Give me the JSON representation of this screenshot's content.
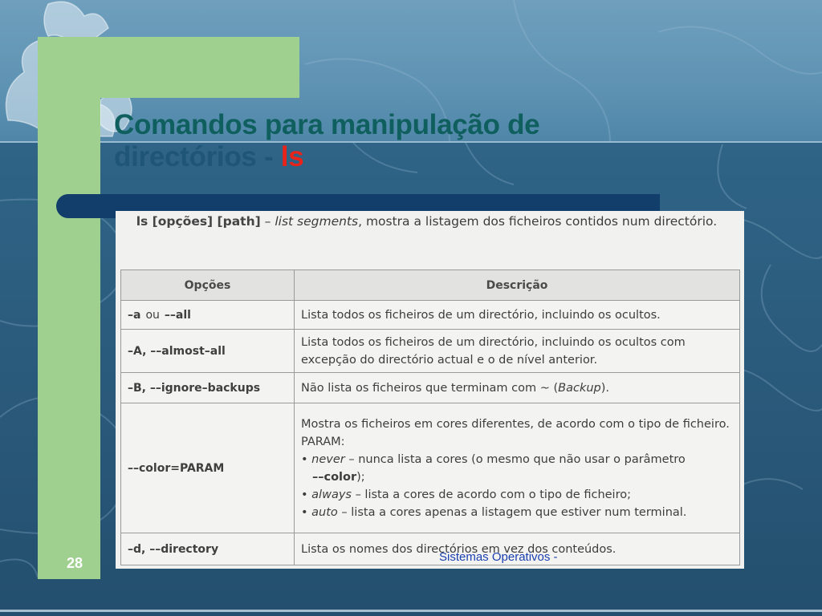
{
  "slide": {
    "title_line1": "Comandos para manipulação de",
    "title_line2": "directórios - ",
    "title_command": "ls",
    "slide_number": "28",
    "footer": "Sistemas Operativos -"
  },
  "doc": {
    "intro_syntax": "ls [opções] [path]",
    "intro_dash": " – ",
    "intro_italic": "list segments",
    "intro_rest": ", mostra a listagem dos ficheiros contidos num directório.",
    "table_headers": {
      "options": "Opções",
      "description": "Descrição"
    },
    "rows": [
      {
        "opt_a": "–a",
        "opt_or": "ou",
        "opt_b": "––all",
        "desc": "Lista todos os ficheiros de um directório, incluindo os ocultos."
      },
      {
        "opt": "–A, ––almost–all",
        "desc": "Lista todos os ficheiros de um directório, incluindo os ocultos com excepção do directório actual e o de nível anterior."
      },
      {
        "opt": "–B, ––ignore–backups",
        "desc_pre": "Não lista os ficheiros que terminam com ~ (",
        "desc_italic": "Backup",
        "desc_post": ")."
      },
      {
        "opt": "––color=PARAM",
        "desc_p1": "Mostra os ficheiros em cores diferentes, de acordo com o tipo de ficheiro.",
        "desc_param": "PARAM:",
        "bullet_never_term": "never",
        "bullet_never_text": " – nunca lista a cores (o mesmo que não usar o parâmetro",
        "bullet_never_bold": "––color",
        "bullet_never_end": ");",
        "bullet_always_term": "always",
        "bullet_always_text": " – lista a cores de acordo com o tipo de ficheiro;",
        "bullet_auto_term": "auto",
        "bullet_auto_text": " – lista a cores apenas a listagem que estiver num terminal."
      },
      {
        "opt": "–d, ––directory",
        "desc": "Lista os nomes dos directórios em vez dos conteúdos."
      }
    ],
    "bullet_char": "•"
  }
}
